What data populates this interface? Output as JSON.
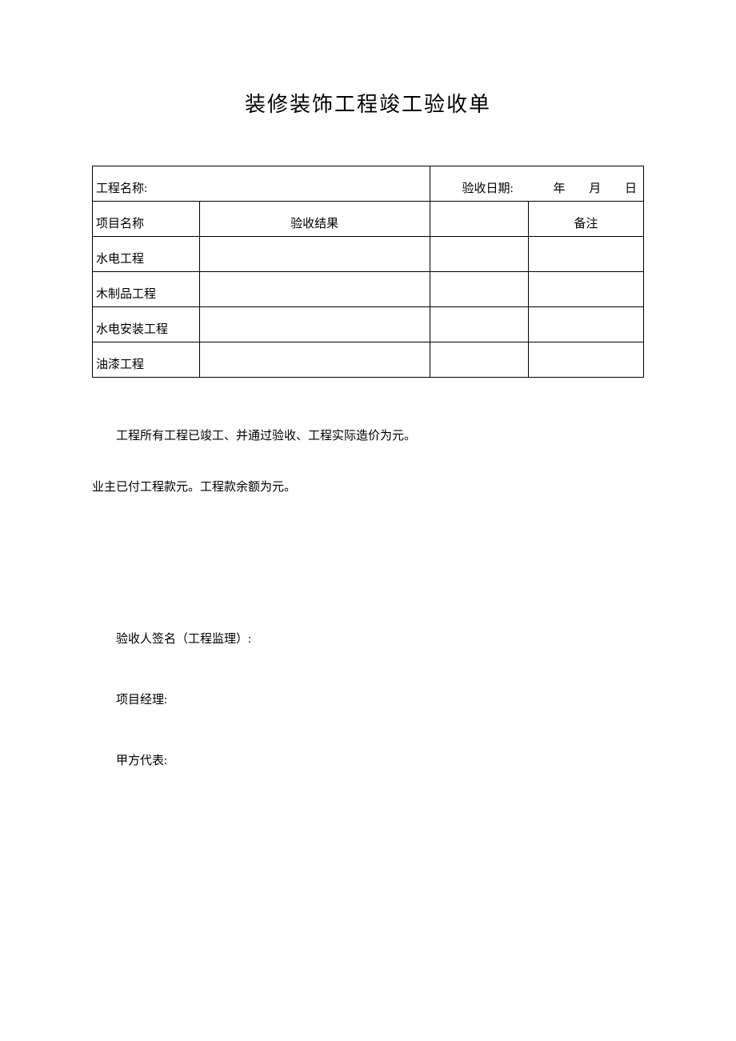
{
  "title": "装修装饰工程竣工验收单",
  "table": {
    "projectNameLabel": "工程名称:",
    "dateLabel": "验收日期:",
    "dateYear": "年",
    "dateMonth": "月",
    "dateDay": "日",
    "headers": {
      "itemName": "项目名称",
      "result": "验收结果",
      "remark": "备注"
    },
    "rows": [
      {
        "label": "水电工程",
        "result": "",
        "extra": "",
        "remark": ""
      },
      {
        "label": "木制品工程",
        "result": "",
        "extra": "",
        "remark": ""
      },
      {
        "label": "水电安装工程",
        "result": "",
        "extra": "",
        "remark": ""
      },
      {
        "label": "油漆工程",
        "result": "",
        "extra": "",
        "remark": ""
      }
    ]
  },
  "paragraphs": {
    "p1": "工程所有工程已竣工、并通过验收、工程实际造价为元。",
    "p2": "业主已付工程款元。工程款余额为元。"
  },
  "signatures": {
    "inspector": "验收人签名（工程监理）:",
    "manager": "项目经理:",
    "partyA": "甲方代表:"
  }
}
